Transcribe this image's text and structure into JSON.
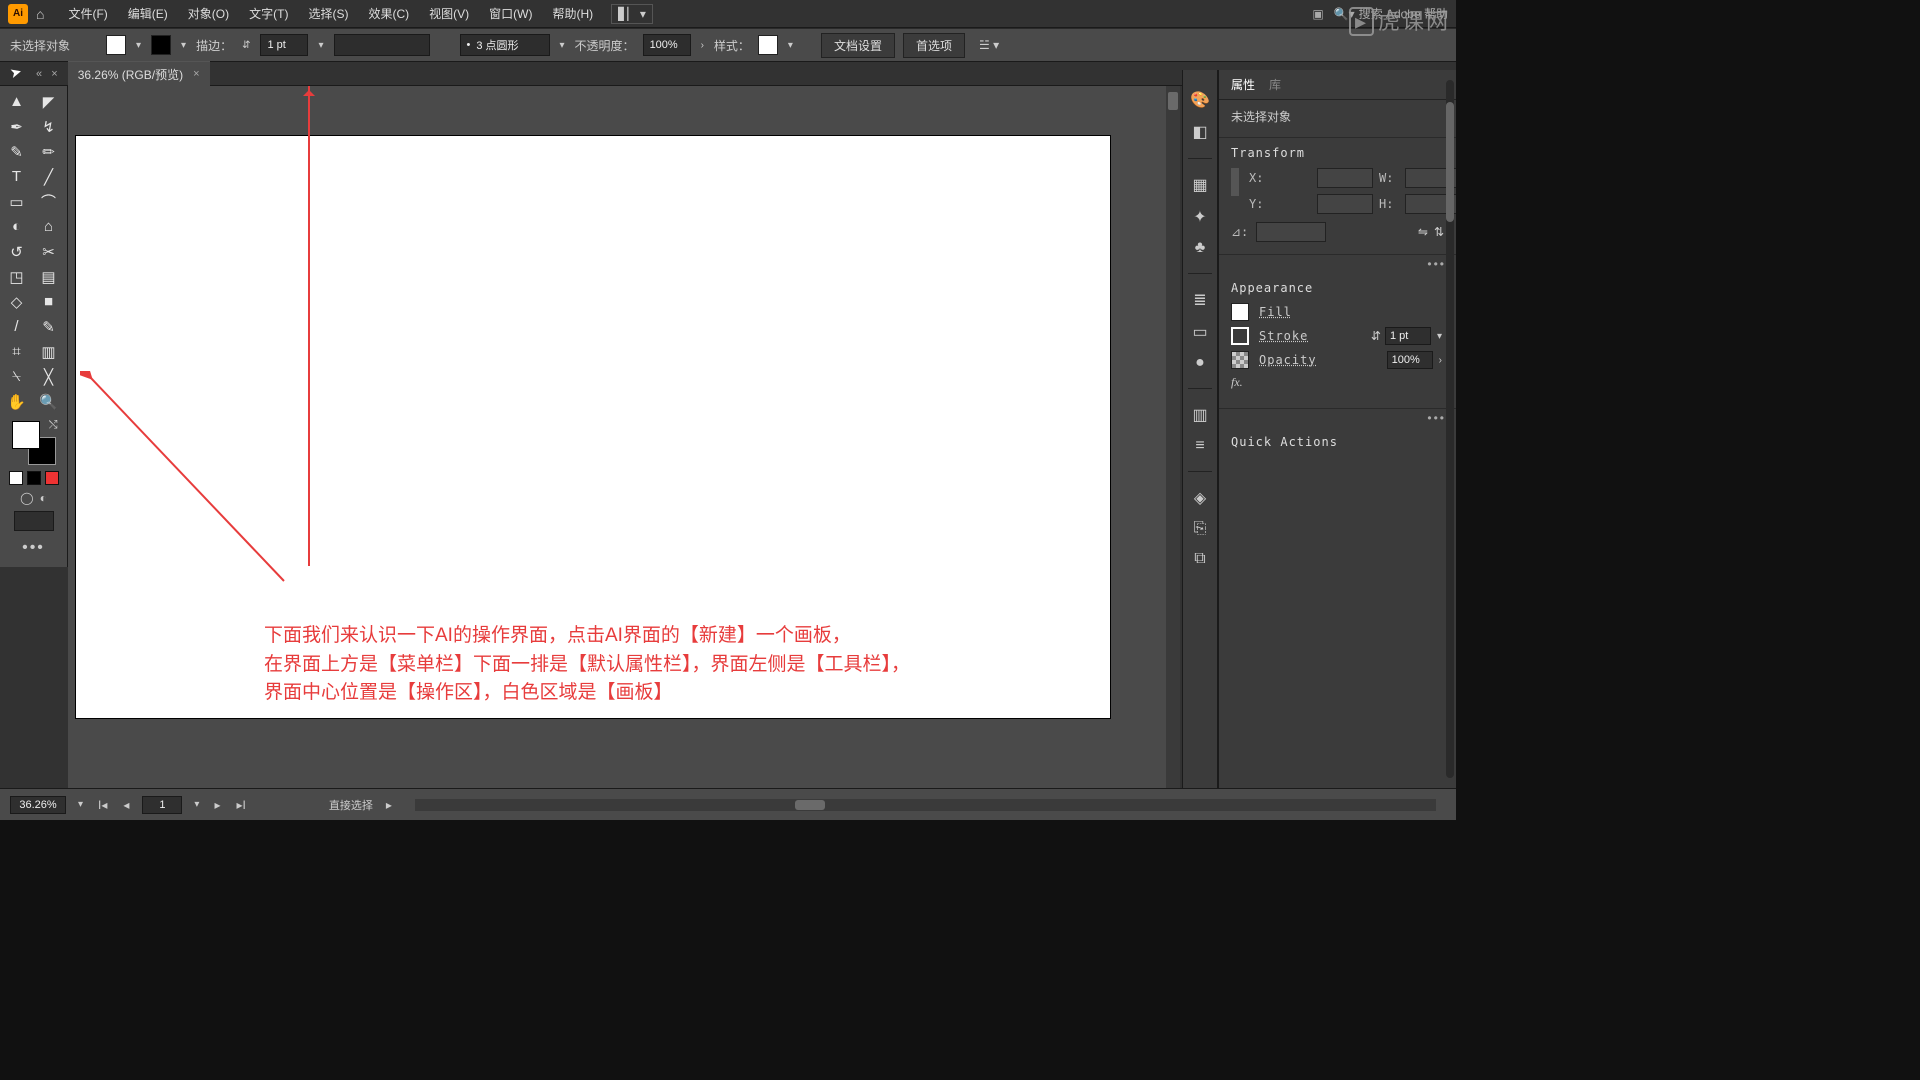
{
  "menubar": {
    "logo": "Ai",
    "items": [
      "文件(F)",
      "编辑(E)",
      "对象(O)",
      "文字(T)",
      "选择(S)",
      "效果(C)",
      "视图(V)",
      "窗口(W)",
      "帮助(H)"
    ],
    "search_placeholder": "搜索 Adobe 帮助"
  },
  "watermark": "虎课网",
  "optionbar": {
    "no_selection": "未选择对象",
    "stroke_label": "描边：",
    "stroke_value": "1 pt",
    "brush_value": "3 点圆形",
    "opacity_label": "不透明度：",
    "opacity_value": "100%",
    "style_label": "样式：",
    "doc_setup": "文档设置",
    "prefs": "首选项"
  },
  "doc_tab": {
    "title": "36.26% (RGB/预览)"
  },
  "properties": {
    "tabs": [
      "属性",
      "库"
    ],
    "no_selection": "未选择对象",
    "transform_title": "Transform",
    "labels": {
      "x": "X:",
      "y": "Y:",
      "w": "W:",
      "h": "H:",
      "ang": "⊿:"
    },
    "appearance_title": "Appearance",
    "fill": "Fill",
    "stroke": "Stroke",
    "stroke_val": "1 pt",
    "opacity": "Opacity",
    "opacity_val": "100%",
    "fx": "fx.",
    "quick_actions": "Quick Actions"
  },
  "status": {
    "zoom": "36.26%",
    "page": "1",
    "tool": "直接选择"
  },
  "annotation": {
    "l1": "下面我们来认识一下AI的操作界面，点击AI界面的【新建】一个画板，",
    "l2": "在界面上方是【菜单栏】下面一排是【默认属性栏】，界面左侧是【工具栏】，",
    "l3": "界面中心位置是【操作区】，白色区域是【画板】"
  },
  "tool_icons": [
    "▲",
    "◤",
    "✒",
    "↯",
    "✎",
    "✏",
    "T",
    "╱",
    "▭",
    "⌒",
    "◐",
    "⌂",
    "↺",
    "✂",
    "◳",
    "▤",
    "◇",
    "■",
    "/",
    "✎",
    "⌗",
    "▥",
    "⍀",
    "╳",
    "✋",
    "🔍"
  ],
  "right_icons": [
    "🎨",
    "◧",
    "▦",
    "✦",
    "♣",
    "≣",
    "▭",
    "●",
    "▥",
    "≡",
    "◈",
    "⎘",
    "⧉"
  ]
}
